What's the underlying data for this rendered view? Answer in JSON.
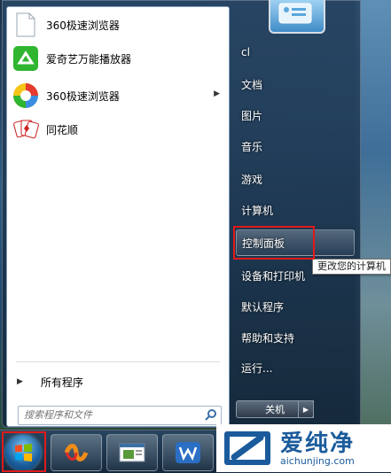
{
  "left_pane": {
    "programs": [
      {
        "label": "360极速浏览器",
        "icon": "blank-document-icon",
        "has_arrow": false
      },
      {
        "label": "爱奇艺万能播放器",
        "icon": "iqiyi-player-icon",
        "has_arrow": false
      },
      {
        "label": "360极速浏览器",
        "icon": "360-browser-icon",
        "has_arrow": true
      },
      {
        "label": "同花顺",
        "icon": "tonghuashun-icon",
        "has_arrow": false
      }
    ],
    "all_programs_label": "所有程序",
    "search_placeholder": "搜索程序和文件"
  },
  "right_pane": {
    "items": [
      {
        "label": "cl"
      },
      {
        "label": "文档"
      },
      {
        "label": "图片"
      },
      {
        "label": "音乐"
      },
      {
        "label": "游戏"
      },
      {
        "label": "计算机"
      },
      {
        "label": "控制面板",
        "highlighted": true
      },
      {
        "label": "设备和打印机"
      },
      {
        "label": "默认程序"
      },
      {
        "label": "帮助和支持"
      },
      {
        "label": "运行..."
      }
    ],
    "shutdown_label": "关机"
  },
  "tooltip": "更改您的计算机",
  "watermark": {
    "main": "爱纯净",
    "sub": "aichunjing.com"
  },
  "colors": {
    "highlight_box": "#e01b1b",
    "watermark": "#1b5b9c"
  }
}
